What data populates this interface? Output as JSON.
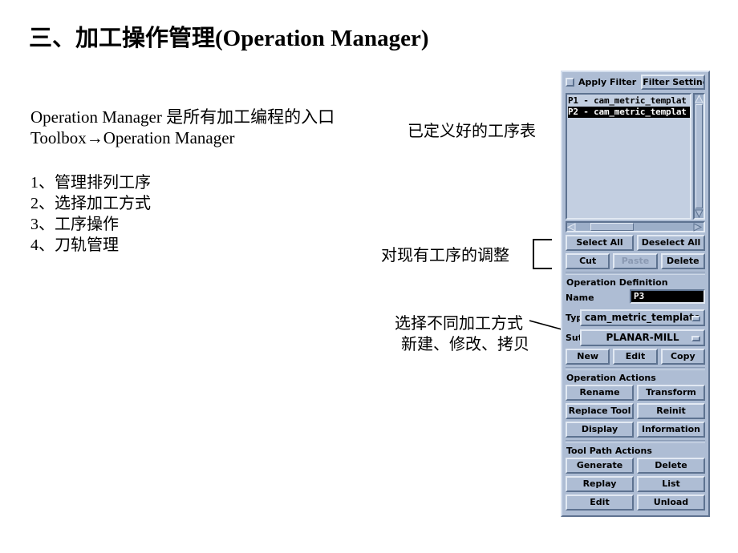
{
  "slide": {
    "title": "三、加工操作管理(Operation Manager)",
    "intro_line_1": "Operation Manager 是所有加工编程的入口",
    "intro_line_2": "Toolbox→Operation Manager",
    "list_items": [
      "1、管理排列工序",
      "2、选择加工方式",
      "3、工序操作",
      "4、刀轨管理"
    ],
    "callouts": {
      "operation_list": "已定义好的工序表",
      "adjust_existing": "对现有工序的调整",
      "select_method_line_1": "选择不同加工方式",
      "select_method_line_2": "新建、修改、拷贝"
    }
  },
  "dialog": {
    "filter": {
      "apply_filter_label": "Apply Filter",
      "apply_filter_checked": false,
      "filter_setting_label": "Filter Setting"
    },
    "operation_list": {
      "items": [
        {
          "label": "P1 - cam_metric_templat",
          "selected": false
        },
        {
          "label": "P2 - cam_metric_templat",
          "selected": true
        }
      ]
    },
    "selection_buttons": {
      "select_all": "Select All",
      "deselect_all": "Deselect All"
    },
    "clipboard_buttons": {
      "cut": "Cut",
      "paste": "Paste",
      "paste_disabled": true,
      "delete": "Delete"
    },
    "operation_definition": {
      "section_title": "Operation Definition",
      "name_label": "Name",
      "name_value": "P3",
      "type_label": "Typ",
      "type_value": "cam_metric_template",
      "subtype_label": "Sut",
      "subtype_value": "PLANAR-MILL",
      "new_label": "New",
      "edit_label": "Edit",
      "copy_label": "Copy"
    },
    "operation_actions": {
      "section_title": "Operation Actions",
      "buttons": [
        [
          "Rename",
          "Transform"
        ],
        [
          "Replace Tool",
          "Reinit"
        ],
        [
          "Display",
          "Information"
        ]
      ]
    },
    "tool_path_actions": {
      "section_title": "Tool Path Actions",
      "buttons": [
        [
          "Generate",
          "Delete"
        ],
        [
          "Replay",
          "List"
        ],
        [
          "Edit",
          "Unload"
        ]
      ]
    }
  },
  "colors": {
    "dialog_face": "#aebdd4",
    "dialog_highlight": "#e2e9f3",
    "dialog_shadow": "#5d7290",
    "list_background": "#c3cfe1",
    "selection": "#000000",
    "text": "#000000"
  }
}
